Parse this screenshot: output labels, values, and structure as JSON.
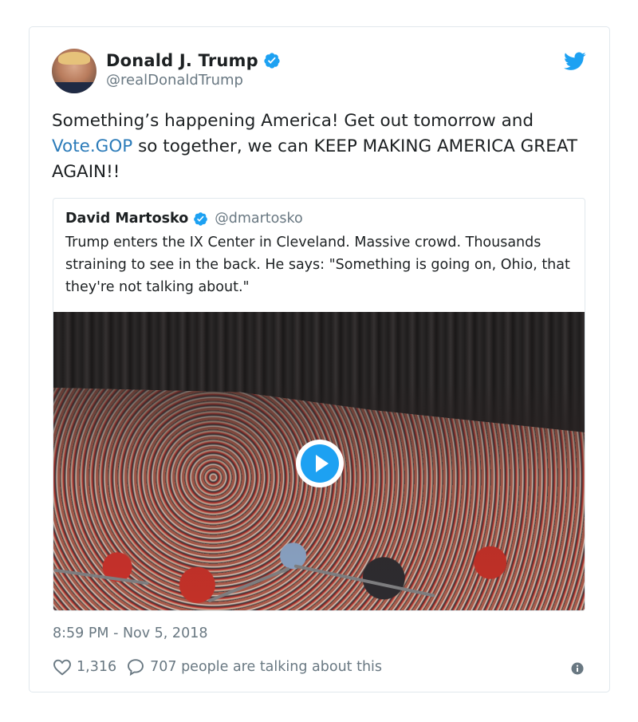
{
  "tweet": {
    "author": {
      "display_name": "Donald J. Trump",
      "handle": "@realDonaldTrump",
      "verified": true
    },
    "text_parts": {
      "before_link": "Something’s happening America! Get out tomorrow and ",
      "link": "Vote.GOP",
      "after_link": " so together, we can KEEP MAKING AMERICA GREAT AGAIN!!"
    },
    "timestamp": "8:59 PM - Nov 5, 2018",
    "likes": "1,316",
    "conversation": "707 people are talking about this"
  },
  "quoted_tweet": {
    "display_name": "David Martosko",
    "handle": "@dmartosko",
    "verified": true,
    "text": "Trump enters the IX Center in Cleveland. Massive crowd. Thousands straining to see in the back. He says: \"Something is going on, Ohio, that they're not talking about.\"",
    "media_type": "video"
  },
  "icons": {
    "verified": "verified-badge-icon",
    "brand": "twitter-bird-icon",
    "like": "heart-icon",
    "reply": "speech-bubble-icon",
    "info": "info-icon",
    "play": "play-icon"
  },
  "colors": {
    "accent": "#1da1f2",
    "link": "#2b7bb9",
    "muted_text": "#697882",
    "border": "#e1e8ed"
  }
}
